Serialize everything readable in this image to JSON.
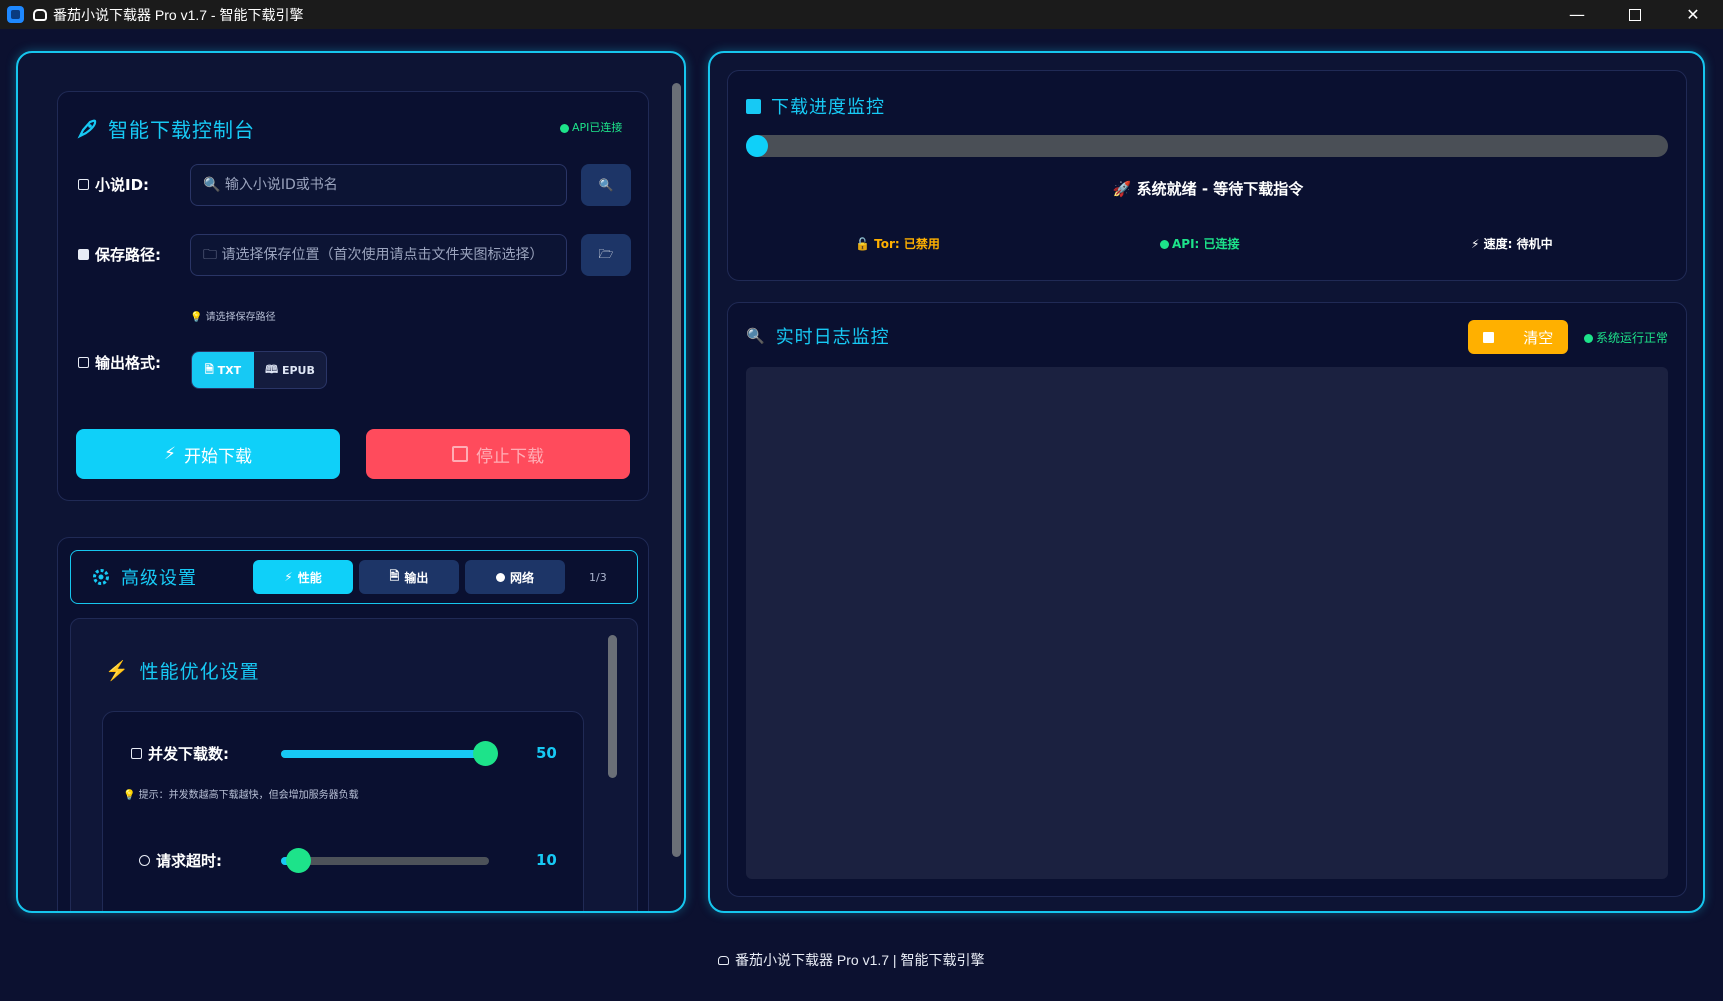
{
  "window": {
    "title": "番茄小说下载器 Pro v1.7 - 智能下载引擎",
    "minimize": "—",
    "close": "✕"
  },
  "control": {
    "title": "智能下载控制台",
    "api_status": "API已连接",
    "novel_id_label": "小说ID:",
    "novel_id_placeholder": "🔍 输入小说ID或书名",
    "search_icon": "🔍",
    "save_path_label": "保存路径:",
    "save_path_placeholder": "🗀 请选择保存位置（首次使用请点击文件夹图标选择）",
    "folder_icon": "🗁",
    "save_path_hint": "💡 请选择保存路径",
    "format_label": "输出格式:",
    "formats": [
      "TXT",
      "EPUB"
    ],
    "selected_format": "TXT",
    "start_label": "开始下载",
    "stop_label": "停止下载"
  },
  "advanced": {
    "title": "高级设置",
    "tabs": [
      "性能",
      "输出",
      "网络"
    ],
    "active_tab": "性能",
    "page_indicator": "1/3",
    "section_title": "性能优化设置",
    "concurrent": {
      "label": "并发下载数:",
      "value": "50",
      "fraction": 0.98,
      "hint": "💡 提示：并发数越高下载越快，但会增加服务器负载"
    },
    "timeout": {
      "label": "请求超时:",
      "value": "10",
      "fraction": 0.08
    }
  },
  "progress": {
    "title": "下载进度监控",
    "percent": 0,
    "status": "系统就绪 - 等待下载指令",
    "tor": "Tor: 已禁用",
    "api": "API: 已连接",
    "speed": "速度: 待机中"
  },
  "log": {
    "title": "实时日志监控",
    "clear_label": "清空",
    "system_status": "系统运行正常"
  },
  "footer": {
    "text": "番茄小说下载器 Pro v1.7 | 智能下载引擎"
  },
  "colors": {
    "accent": "#17c9f4",
    "green": "#1de38a",
    "stop": "#ff4b5c",
    "clear": "#ffb000"
  }
}
